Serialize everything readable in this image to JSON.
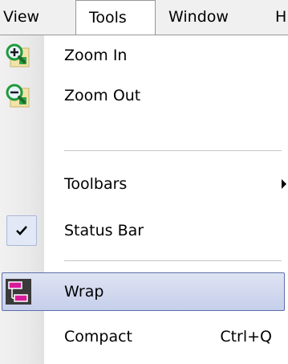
{
  "menubar": {
    "items": [
      {
        "label": "View"
      },
      {
        "label": "Tools"
      },
      {
        "label": "Window"
      },
      {
        "label": "H"
      }
    ]
  },
  "menu": {
    "zoom_in": {
      "label": "Zoom In",
      "icon": "zoom-in-icon"
    },
    "zoom_out": {
      "label": "Zoom Out",
      "icon": "zoom-out-icon"
    },
    "toolbars": {
      "label": "Toolbars",
      "has_submenu": true
    },
    "status_bar": {
      "label": "Status Bar",
      "checked": true
    },
    "wrap": {
      "label": "Wrap",
      "icon": "wrap-icon",
      "highlighted": true
    },
    "compact": {
      "label": "Compact",
      "shortcut": "Ctrl+Q"
    }
  },
  "colors": {
    "highlight_border": "#5d6fa8",
    "highlight_fill": "#c6cfeb",
    "wrap_icon_accent": "#d81b9a",
    "zoom_icon_green": "#1f9a3a"
  }
}
